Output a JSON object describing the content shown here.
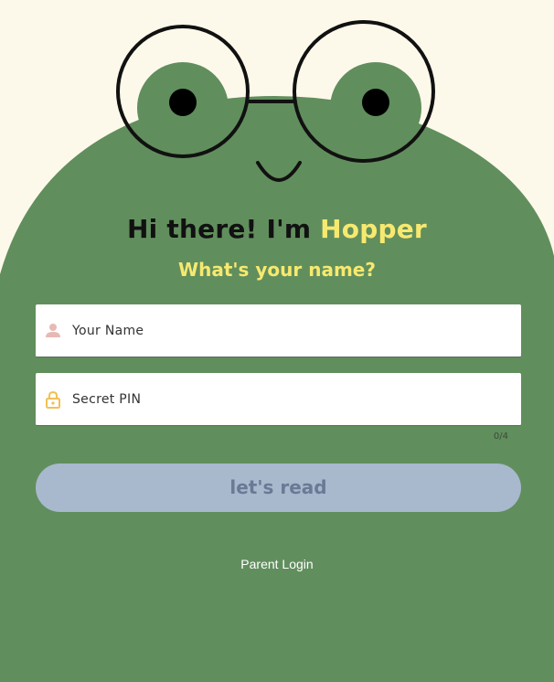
{
  "theme": {
    "background": "#fdf9ea",
    "frog_green": "#618e5d",
    "accent_yellow": "#f7e96f",
    "button_bg": "#a8b8cd",
    "button_text": "#6a7a95"
  },
  "mascot": {
    "icon": "frog-with-glasses"
  },
  "greeting": {
    "prefix": "Hi there! I'm ",
    "name": "Hopper",
    "question": "What's your name?"
  },
  "form": {
    "name_field": {
      "icon": "person-icon",
      "placeholder": "Your Name",
      "value": ""
    },
    "pin_field": {
      "icon": "lock-icon",
      "placeholder": "Secret PIN",
      "value": "",
      "counter": "0/4"
    },
    "submit_label": "let's read"
  },
  "footer": {
    "parent_login_label": "Parent Login"
  }
}
